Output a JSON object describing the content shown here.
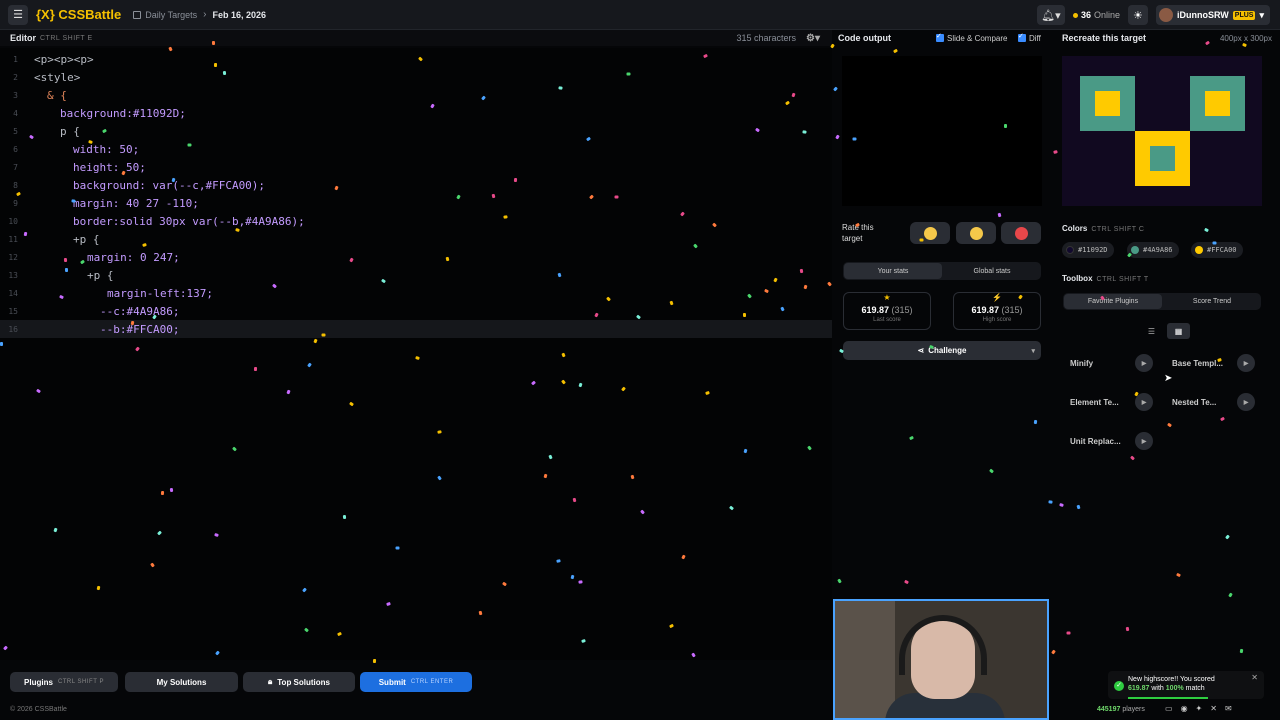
{
  "topbar": {
    "logo": "{X} CSSBattle",
    "crumb_section": "Daily Targets",
    "crumb_date": "Feb 16, 2026",
    "online_count": "36",
    "online_label": "Online",
    "username": "iDunnoSRW",
    "plus": "PLUS"
  },
  "editor": {
    "title": "Editor",
    "shortcut": "CTRL SHIFT E",
    "chars": "315 characters",
    "lines": [
      {
        "n": "1",
        "text": "<p><p><p>"
      },
      {
        "n": "2",
        "text": "<style>"
      },
      {
        "n": "3",
        "text": "& {"
      },
      {
        "n": "4",
        "text": "background:#11092D;"
      },
      {
        "n": "5",
        "text": "p {"
      },
      {
        "n": "6",
        "text": "width: 50;"
      },
      {
        "n": "7",
        "text": "height: 50;"
      },
      {
        "n": "8",
        "text": "background: var(--c,#FFCA00);"
      },
      {
        "n": "9",
        "text": "margin: 40 27 -110;"
      },
      {
        "n": "10",
        "text": "border:solid 30px var(--b,#4A9A86);"
      },
      {
        "n": "11",
        "text": "+p {"
      },
      {
        "n": "12",
        "text": "margin: 0 247;"
      },
      {
        "n": "13",
        "text": "+p {"
      },
      {
        "n": "14",
        "text": "margin-left:137;"
      },
      {
        "n": "15",
        "text": "--c:#4A9A86;"
      },
      {
        "n": "16",
        "text": "--b:#FFCA00;"
      }
    ]
  },
  "output": {
    "title": "Code output",
    "slide_compare": "Slide & Compare",
    "diff": "Diff",
    "rate_label": "Rate this target",
    "tab_your": "Your stats",
    "tab_global": "Global stats",
    "last_score": "619.87",
    "last_chars": "(315)",
    "last_label": "Last score",
    "high_score": "619.87",
    "high_chars": "(315)",
    "high_label": "High score",
    "challenge": "Challenge"
  },
  "target": {
    "title": "Recreate this target",
    "size": "400px x 300px",
    "colors": {
      "bg": "#110920",
      "teal": "#4A9A86",
      "yellow": "#FFCA00"
    }
  },
  "colors": {
    "title": "Colors",
    "shortcut": "CTRL SHIFT C",
    "items": [
      {
        "hex": "#11092D",
        "swatch": "#11092D"
      },
      {
        "hex": "#4A9A86",
        "swatch": "#4A9A86"
      },
      {
        "hex": "#FFCA00",
        "swatch": "#FFCA00"
      }
    ]
  },
  "toolbox": {
    "title": "Toolbox",
    "shortcut": "CTRL SHIFT T",
    "tab_fav": "Favorite Plugins",
    "tab_trend": "Score Trend",
    "plugins": [
      "Minify",
      "Base Templ...",
      "Element Te...",
      "Nested Te...",
      "Unit Replac..."
    ]
  },
  "bottom": {
    "plugins": "Plugins",
    "plugins_kbd": "CTRL SHIFT P",
    "my_solutions": "My Solutions",
    "top_solutions": "Top Solutions",
    "submit": "Submit",
    "submit_kbd": "CTRL ENTER",
    "copyright": "© 2026 CSSBattle",
    "players_count": "445197",
    "players_label": "players"
  },
  "toast": {
    "line1": "New highscore!! You scored",
    "score": "619.87",
    "with": "with",
    "match": "100%",
    "match_label": "match"
  }
}
